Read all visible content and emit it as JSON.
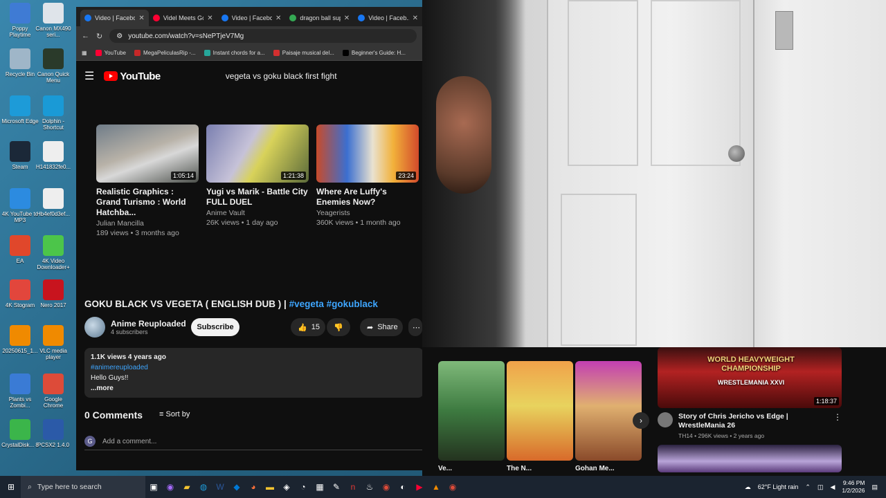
{
  "desktop": {
    "icons": [
      {
        "label": "Poppy Playtime",
        "icon": "poppy-playtime-icon",
        "color": "#3f7bd4"
      },
      {
        "label": "Canon MX490 seri...",
        "icon": "printer-icon",
        "color": "#dfe4ea"
      },
      {
        "label": "Recycle Bin",
        "icon": "recycle-bin-icon",
        "color": "#9fb6c8"
      },
      {
        "label": "Canon Quick Menu",
        "icon": "canon-quick-menu-icon",
        "color": "#2a3a2a"
      },
      {
        "label": "Microsoft Edge",
        "icon": "edge-icon",
        "color": "#1d9bd8"
      },
      {
        "label": "Dolphin - Shortcut",
        "icon": "dolphin-icon",
        "color": "#1a9ad6"
      },
      {
        "label": "Steam",
        "icon": "steam-icon",
        "color": "#1b2838"
      },
      {
        "label": "H141832fe0...",
        "icon": "image-file-icon",
        "color": "#eeeeee"
      },
      {
        "label": "4K YouTube to MP3",
        "icon": "4k-youtube-mp3-icon",
        "color": "#2c8be0"
      },
      {
        "label": "Hb4ef0d3ef...",
        "icon": "image-file-icon",
        "color": "#eeeeee"
      },
      {
        "label": "EA",
        "icon": "ea-icon",
        "color": "#e0472b"
      },
      {
        "label": "4K Video Downloader+",
        "icon": "4k-video-downloader-icon",
        "color": "#4cc54a"
      },
      {
        "label": "4K Stogram",
        "icon": "4k-stogram-icon",
        "color": "#e2463c"
      },
      {
        "label": "Nero 2017",
        "icon": "nero-icon",
        "color": "#c8141e"
      },
      {
        "label": "20250615_1...",
        "icon": "vlc-file-icon",
        "color": "#f08a00"
      },
      {
        "label": "VLC media player",
        "icon": "vlc-icon",
        "color": "#f08a00"
      },
      {
        "label": "Plants vs Zombi...",
        "icon": "plants-vs-zombies-icon",
        "color": "#3a7bd5"
      },
      {
        "label": "Google Chrome",
        "icon": "chrome-icon",
        "color": "#dd4b39"
      },
      {
        "label": "CrystalDisk... 8",
        "icon": "crystaldisk-icon",
        "color": "#3bb54a"
      },
      {
        "label": "PCSX2 1.4.0",
        "icon": "pcsx2-icon",
        "color": "#2b5aa8"
      }
    ]
  },
  "browser": {
    "tabs": [
      {
        "title": "Video | Facebo...",
        "icon_color": "#1877f2",
        "active": true
      },
      {
        "title": "Videl Meets Go...",
        "icon_color": "#ff0033",
        "active": false
      },
      {
        "title": "Video | Facebo...",
        "icon_color": "#1877f2",
        "active": false
      },
      {
        "title": "dragon ball sup...",
        "icon_color": "#34a853",
        "active": false
      },
      {
        "title": "Video | Faceb...",
        "icon_color": "#1877f2",
        "active": false
      }
    ],
    "url": "youtube.com/watch?v=sNePTjeV7Mg",
    "bookmarks": [
      {
        "label": "YouTube",
        "color": "#ff0033"
      },
      {
        "label": "MegaPeliculasRip -...",
        "color": "#c62828"
      },
      {
        "label": "Instant chords for a...",
        "color": "#26a69a"
      },
      {
        "label": "Paisaje musical del...",
        "color": "#d32f2f"
      },
      {
        "label": "Beginner's Guide: H...",
        "color": "#000000"
      }
    ]
  },
  "youtube": {
    "logo": "YouTube",
    "search_query": "vegeta vs goku black first fight",
    "related": [
      {
        "title": "Realistic Graphics : Grand Turismo : World Hatchba...",
        "channel": "Julian Mancilla",
        "meta": "189 views • 3 months ago",
        "duration": "1:05:14",
        "thumb": "linear-gradient(160deg,#6f7c88,#b8b2a8 45%,#d8d8d8 60%,#4b4f4a)"
      },
      {
        "title": "Yugi vs Marik - Battle City FULL DUEL",
        "channel": "Anime Vault",
        "meta": "26K views • 1 day ago",
        "duration": "1:21:38",
        "thumb": "linear-gradient(120deg,#7a7fb0,#c6c2d8 40%,#d8d25a 55%,#5b6a3a)"
      },
      {
        "title": "Where Are Luffy's Enemies Now?",
        "channel": "Yeagerists",
        "meta": "360K views • 1 month ago",
        "duration": "23:24",
        "thumb": "linear-gradient(90deg,#c84b2a,#3b6fd0 30%,#e9e2d0 55%,#f2b13a 75%,#d24a2b)"
      }
    ],
    "video": {
      "title": "GOKU BLACK VS VEGETA ( ENGLISH DUB ) |",
      "hashtags": "#vegeta #gokublack",
      "channel": "Anime Reuploaded",
      "subscribers": "4 subscribers",
      "subscribe_label": "Subscribe",
      "likes": "15",
      "share_label": "Share",
      "views": "1.1K views  4 years ago",
      "desc_hashtag": "#animereuploaded",
      "desc_text": "Hello Guys!!",
      "more": "...more"
    },
    "comments": {
      "count_label": "0 Comments",
      "sort_label": "Sort by",
      "add_placeholder": "Add a comment...",
      "avatar_letter": "G"
    }
  },
  "right_panel": {
    "shorts": [
      {
        "title": "Ve...",
        "thumb": "linear-gradient(180deg,#7fb97a,#3d7a40 50%,#24331f)"
      },
      {
        "title": "The N...",
        "thumb": "linear-gradient(180deg,#f0a24a,#e8d35e 45%,#d86a2a)"
      },
      {
        "title": "Gohan Me...",
        "thumb": "linear-gradient(180deg,#c33fb2,#e0b070 45%,#8a4a2a)"
      }
    ],
    "featured": {
      "title": "Story of Chris Jericho vs Edge | WrestleMania 26",
      "channel": "TH14",
      "meta": "296K views • 2 years ago",
      "duration": "1:18:37",
      "banner": "WORLD HEAVYWEIGHT CHAMPIONSHIP",
      "subbanner": "WRESTLEMANIA XXVI"
    }
  },
  "taskbar": {
    "search_placeholder": "Type here to search",
    "weather": "62°F  Light rain",
    "time": "9:46 PM",
    "date": "1/2/2026"
  }
}
